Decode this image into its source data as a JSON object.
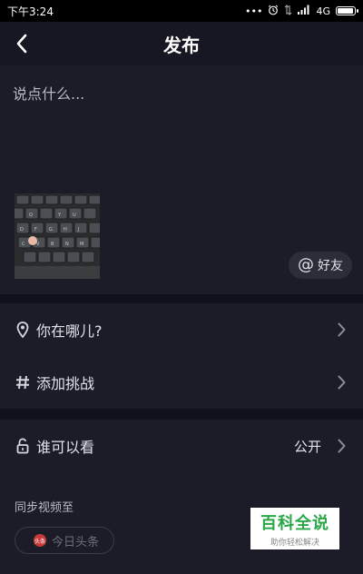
{
  "status_bar": {
    "time": "下午3:24",
    "dots": "•••",
    "network": "4G"
  },
  "nav": {
    "title": "发布"
  },
  "compose": {
    "placeholder": "说点什么...",
    "friends_chip": "好友"
  },
  "rows": {
    "location": {
      "label": "你在哪儿?"
    },
    "challenge": {
      "label": "添加挑战"
    },
    "visibility": {
      "label": "谁可以看",
      "value": "公开"
    }
  },
  "sync": {
    "title": "同步视频至",
    "toutiao_label": "今日头条",
    "toutiao_logo_text": "头条"
  },
  "watermark": {
    "title": "百科全说",
    "subtitle": "助你轻松解决"
  },
  "colors": {
    "background": "#0f111a",
    "panel": "#1b1c28",
    "brand_watermark": "#2aa747"
  }
}
